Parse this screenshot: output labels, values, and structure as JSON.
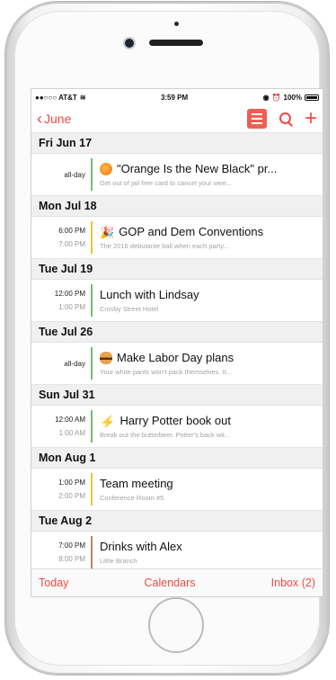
{
  "status_bar": {
    "carrier": "●●○○○ AT&T",
    "time": "3:59 PM",
    "battery": "100%"
  },
  "nav": {
    "back_label": "June"
  },
  "colors": {
    "accent": "#ee4a43",
    "green_calendar": "#6fbf73",
    "yellow_calendar": "#f2c230",
    "brown_calendar": "#b58a5c"
  },
  "days": [
    {
      "header": "Fri Jun 17",
      "events": [
        {
          "time1": "all-day",
          "time2": "",
          "icon": "orange-emoji-icon",
          "title": "\"Orange Is the New Black\" pr...",
          "sub": "Get out of jail free card to cancel your wee...",
          "bar_color": "#6fbf73"
        }
      ]
    },
    {
      "header": "Mon Jul 18",
      "events": [
        {
          "time1": "6:00 PM",
          "time2": "7:00 PM",
          "icon": "party-popper-icon",
          "title": "GOP and Dem Conventions",
          "sub": "The 2016 debutante ball when each party...",
          "bar_color": "#f2c230"
        }
      ]
    },
    {
      "header": "Tue Jul 19",
      "events": [
        {
          "time1": "12:00 PM",
          "time2": "1:00 PM",
          "icon": "",
          "title": "Lunch with Lindsay",
          "sub": "Crosby Street Hotel",
          "bar_color": "#6fbf73"
        }
      ]
    },
    {
      "header": "Tue Jul 26",
      "events": [
        {
          "time1": "all-day",
          "time2": "",
          "icon": "hamburger-emoji-icon",
          "title": "Make Labor Day plans",
          "sub": "Your white pants won't pack themselves. It...",
          "bar_color": "#6fbf73"
        }
      ]
    },
    {
      "header": "Sun Jul 31",
      "events": [
        {
          "time1": "12:00 AM",
          "time2": "1:00 AM",
          "icon": "lightning-icon",
          "title": "Harry Potter book out",
          "sub": "Break out the butterbeer. Potter's back wit...",
          "bar_color": "#6fbf73"
        }
      ]
    },
    {
      "header": "Mon Aug 1",
      "events": [
        {
          "time1": "1:00 PM",
          "time2": "2:00 PM",
          "icon": "",
          "title": "Team meeting",
          "sub": "Conference Room #5",
          "bar_color": "#f2c230"
        }
      ]
    },
    {
      "header": "Tue Aug 2",
      "events": [
        {
          "time1": "7:00 PM",
          "time2": "8:00 PM",
          "icon": "",
          "title": "Drinks with Alex",
          "sub": "Little Branch",
          "bar_color": "#b58a5c"
        }
      ]
    }
  ],
  "tab_bar": {
    "today": "Today",
    "calendars": "Calendars",
    "inbox": "Inbox (2)"
  }
}
